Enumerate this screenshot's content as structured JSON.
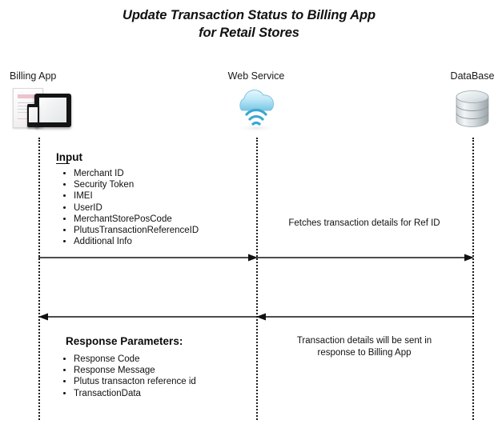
{
  "title": {
    "line1": "Update Transaction Status to Billing App",
    "line2": "for Retail Stores"
  },
  "actors": [
    {
      "id": "billing",
      "label": "Billing App",
      "icon": "devices-icon"
    },
    {
      "id": "webservice",
      "label": "Web Service",
      "icon": "cloud-wifi-icon"
    },
    {
      "id": "database",
      "label": "DataBase",
      "icon": "database-cylinder-icon"
    }
  ],
  "input": {
    "heading": "Input",
    "items": [
      "Merchant ID",
      "Security Token",
      "IMEI",
      "UserID",
      "MerchantStorePosCode",
      "PlutusTransactionReferenceID",
      "Additional Info"
    ]
  },
  "response": {
    "heading": "Response Parameters:",
    "items": [
      "Response Code",
      "Response Message",
      "Plutus transacton reference id",
      "TransactionData"
    ]
  },
  "notes": {
    "fetch": "Fetches transaction details for Ref ID",
    "response_line1": "Transaction details will be sent in",
    "response_line2": "response to Billing App"
  },
  "arrows": [
    {
      "id": "request-webservice",
      "from": "Billing App",
      "to": "Web Service",
      "direction": "right"
    },
    {
      "id": "request-database",
      "from": "Web Service",
      "to": "DataBase",
      "direction": "right"
    },
    {
      "id": "response-webservice",
      "from": "Web Service",
      "to": "Billing App",
      "direction": "left"
    },
    {
      "id": "response-database",
      "from": "DataBase",
      "to": "Web Service",
      "direction": "left"
    }
  ],
  "colors": {
    "background": "#ffffff",
    "text": "#111111",
    "lifeline": "#1c1c1c",
    "arrow": "#111111",
    "cloud": "#9cd6ef",
    "database": "#b9c0c4"
  }
}
